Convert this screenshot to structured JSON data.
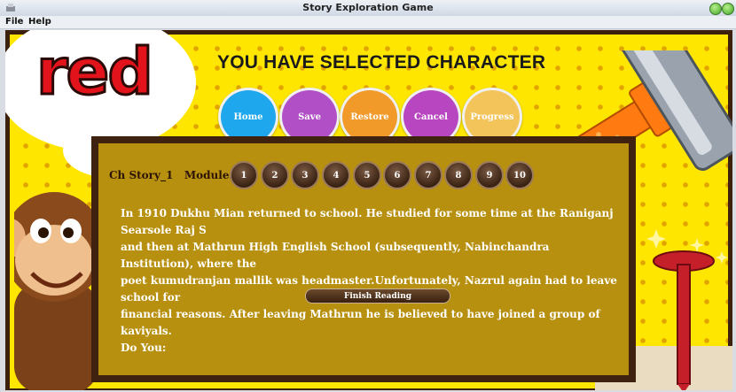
{
  "window": {
    "title": "Story Exploration Game"
  },
  "menu": {
    "file": "File",
    "help": "Help"
  },
  "banner": {
    "word": "red"
  },
  "heading": "YOU HAVE SELECTED CHARACTER",
  "nav_buttons": [
    {
      "label": "Home",
      "color": "#1ea7ec"
    },
    {
      "label": "Save",
      "color": "#b14fc6"
    },
    {
      "label": "Restore",
      "color": "#f19a2a"
    },
    {
      "label": "Cancel",
      "color": "#b846c0"
    },
    {
      "label": "Progress",
      "color": "#f2c45a"
    }
  ],
  "panel": {
    "story_label": "Ch Story_1",
    "modules_label": "Modules",
    "modules": [
      "1",
      "2",
      "3",
      "4",
      "5",
      "6",
      "7",
      "8",
      "9",
      "10"
    ],
    "story_text": "In 1910 Dukhu Mian returned to school. He studied for some time at the Raniganj Searsole Raj S\nand then at Mathrun High English School (subsequently, Nabinchandra Institution), where the\npoet  kumudranjan mallik was headmaster.Unfortunately, Nazrul again had to leave school for\n financial reasons. After leaving Mathrun he is believed to have joined a group of kaviyals.\nDo You:",
    "finish_label": "Finish Reading"
  }
}
